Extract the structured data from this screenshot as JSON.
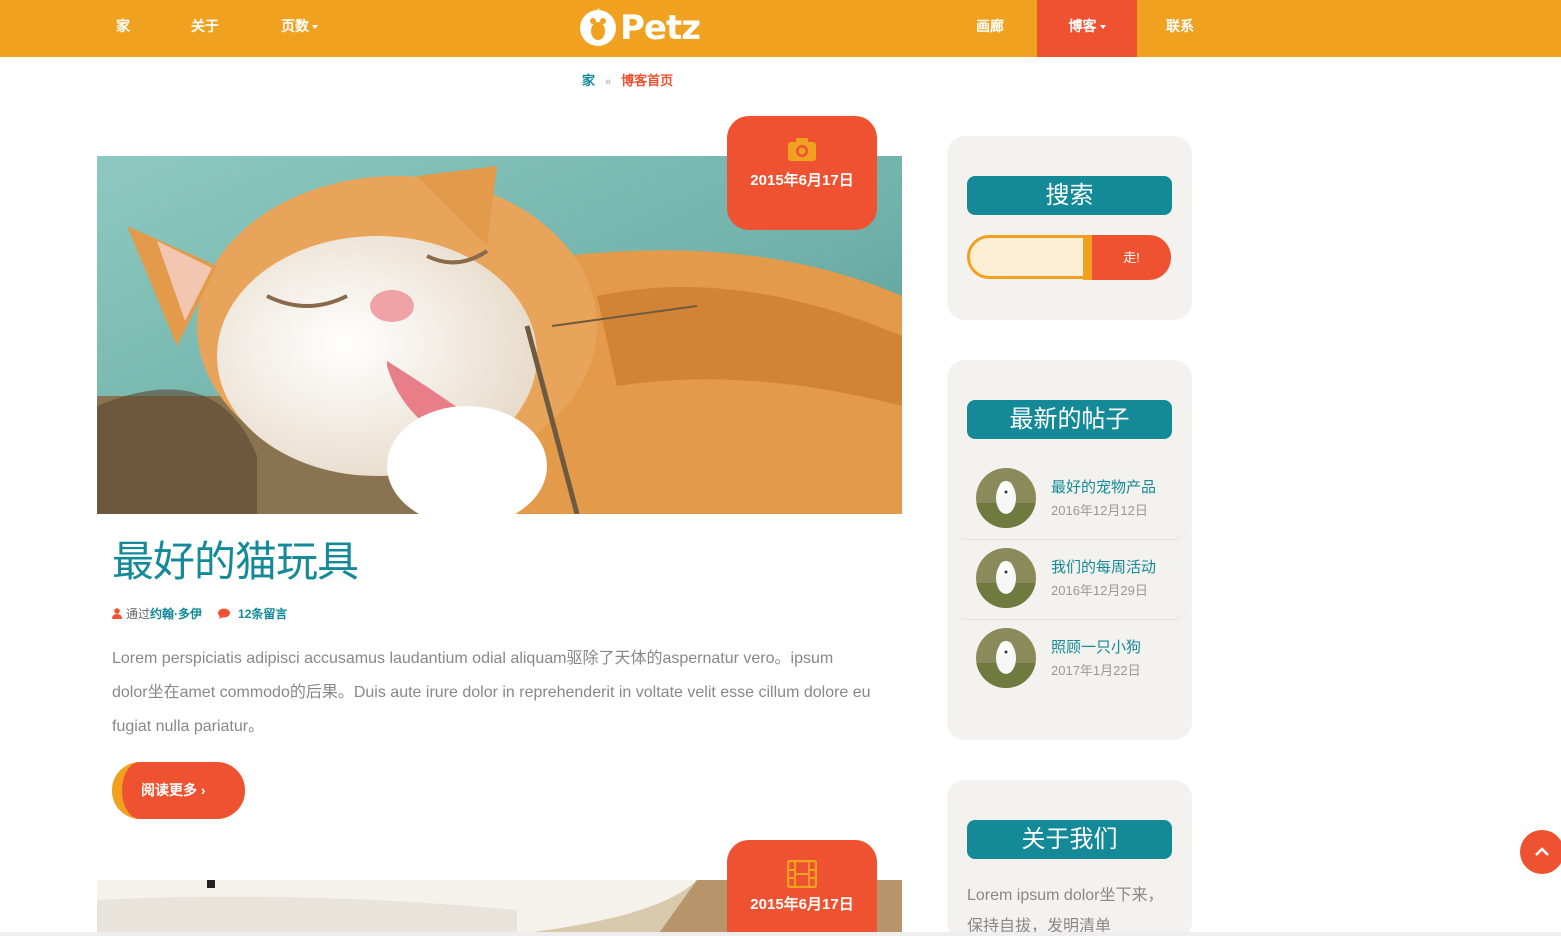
{
  "nav": {
    "left": [
      {
        "label": "家"
      },
      {
        "label": "关于"
      },
      {
        "label": "页数"
      }
    ],
    "logo": "Petz",
    "right": [
      {
        "label": "画廊"
      },
      {
        "label": "博客"
      },
      {
        "label": "联系"
      }
    ],
    "active": "博客"
  },
  "breadcrumb": {
    "home": "家",
    "separator": "»",
    "current": "博客首页"
  },
  "posts": [
    {
      "date": "2015年6月17日",
      "icon": "camera-icon",
      "title": "最好的猫玩具",
      "by": "通过",
      "author": "约翰·多伊",
      "comments": "12条留言",
      "excerpt": "Lorem perspiciatis adipisci accusamus laudantium odial aliquam驱除了天体的aspernatur vero。ipsum dolor坐在amet commodo的后果。Duis aute irure dolor in reprehenderit in voltate velit esse cillum dolore eu fugiat nulla pariatur。",
      "read_more": "阅读更多 ›"
    },
    {
      "date": "2015年6月17日",
      "icon": "film-icon"
    }
  ],
  "sidebar": {
    "search": {
      "title": "搜索",
      "placeholder": "",
      "button": "走!"
    },
    "recent": {
      "title": "最新的帖子",
      "items": [
        {
          "title": "最好的宠物产品",
          "date": "2016年12月12日"
        },
        {
          "title": "我们的每周活动",
          "date": "2016年12月29日"
        },
        {
          "title": "照顾一只小狗",
          "date": "2017年1月22日"
        }
      ]
    },
    "about": {
      "title": "关于我们",
      "text": "Lorem ipsum dolor坐下来，保持自拔，发明清单"
    }
  },
  "colors": {
    "orange": "#f0a120",
    "red": "#ee5230",
    "teal": "#148a98",
    "panel": "#f4f2ee"
  }
}
